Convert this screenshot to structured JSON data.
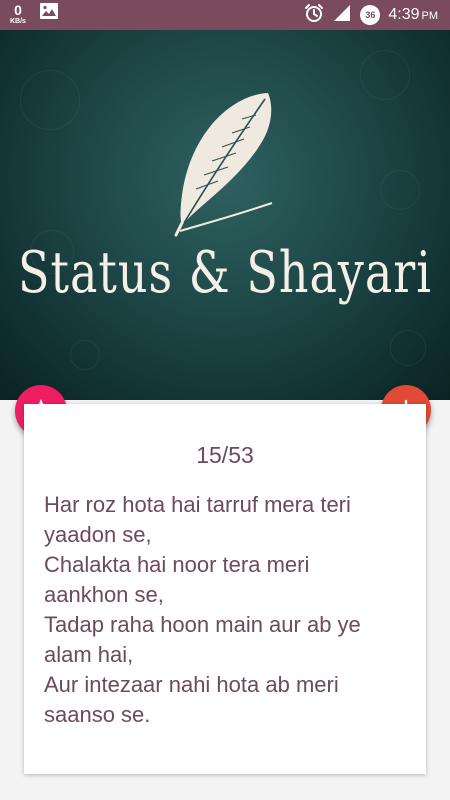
{
  "status_bar": {
    "net_speed_value": "0",
    "net_speed_unit": "KB/s",
    "time": "4:39",
    "ampm": "PM",
    "badge": "36",
    "icons": [
      "image-icon",
      "alarm-icon",
      "signal-icon",
      "data-badge-icon"
    ]
  },
  "header": {
    "title": "Status & Shayari",
    "logo_icon": "feather-quill-icon"
  },
  "fab_star": {
    "icon": "star-icon",
    "color": "#ee1e63"
  },
  "fab_add": {
    "icon": "plus-icon",
    "color": "#e04a36"
  },
  "card": {
    "counter": "15/53",
    "lines": [
      "Har roz hota hai tarruf mera teri",
      "yaadon se,",
      "Chalakta hai noor tera meri",
      "aankhon se,",
      "Tadap raha hoon main aur ab ye",
      "alam hai,",
      "Aur intezaar nahi hota ab meri",
      "saanso se."
    ]
  },
  "colors": {
    "status_bar": "#7a4a5e",
    "banner": "#1d4746",
    "text": "#6d4a5c"
  }
}
